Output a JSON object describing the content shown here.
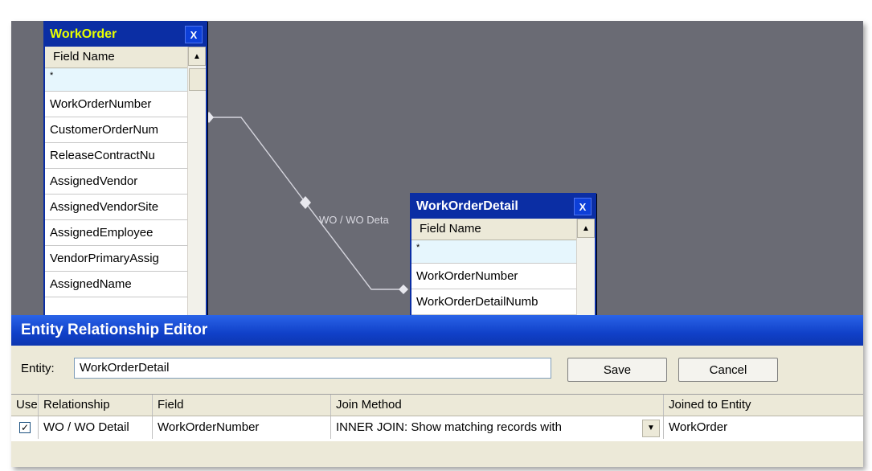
{
  "work_order_table": {
    "title": "WorkOrder",
    "close_label": "X",
    "header": "Field Name",
    "star": "*",
    "fields": [
      "WorkOrderNumber",
      "CustomerOrderNum",
      "ReleaseContractNu",
      "AssignedVendor",
      "AssignedVendorSite",
      "AssignedEmployee",
      "VendorPrimaryAssig",
      "AssignedName"
    ]
  },
  "detail_table": {
    "title": "WorkOrderDetail",
    "close_label": "X",
    "header": "Field Name",
    "star": "*",
    "fields": [
      "WorkOrderNumber",
      "WorkOrderDetailNumb"
    ]
  },
  "relationship_label": "WO / WO Deta",
  "editor": {
    "title": "Entity Relationship Editor",
    "entity_label": "Entity:",
    "entity_value": "WorkOrderDetail",
    "save_label": "Save",
    "cancel_label": "Cancel",
    "columns": [
      "Use",
      "Relationship",
      "Field",
      "Join Method",
      "Joined to Entity"
    ],
    "row": {
      "use_check": "✓",
      "relationship": "WO / WO Detail",
      "field": "WorkOrderNumber",
      "join_method": "INNER JOIN: Show matching records with",
      "joined_to": "WorkOrder"
    }
  },
  "colors": {
    "canvas": "#6a6b74",
    "table_frame": "#0b2ea4",
    "workorder_title": "#e8ff00"
  }
}
